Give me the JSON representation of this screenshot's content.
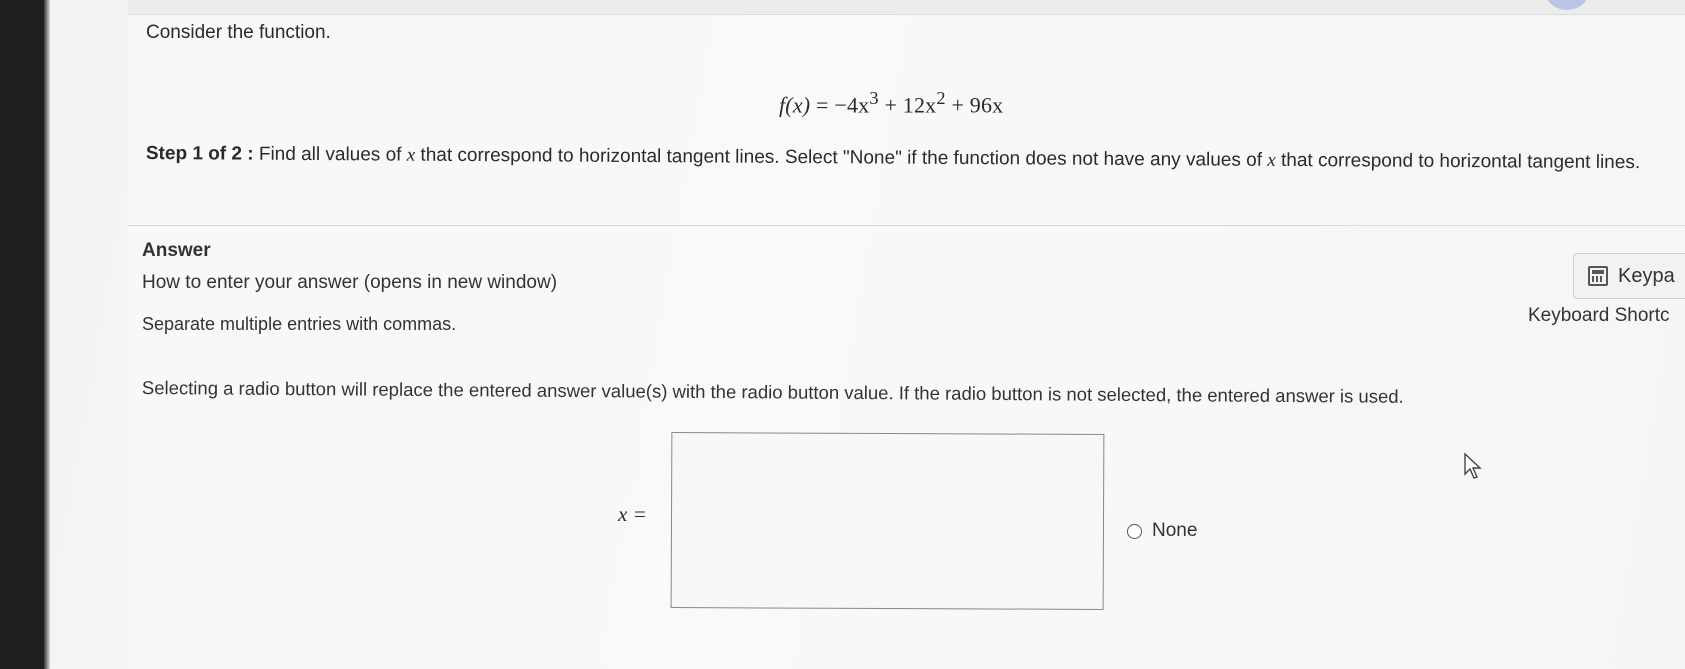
{
  "question": {
    "intro": "Consider the function.",
    "equation": {
      "lhs": "f(x)",
      "equals": "=",
      "term1": "−4x",
      "exp1": "3",
      "plus1": "+",
      "term2": "12x",
      "exp2": "2",
      "plus2": "+",
      "term3": "96x"
    },
    "step": {
      "label": "Step 1 of 2 :",
      "text_before_x": "Find all values of",
      "x1": "x",
      "text_middle": "that correspond to horizontal tangent lines. Select \"None\" if the function does not have any values of",
      "x2": "x",
      "text_after": "that correspond to horizontal tangent lines."
    }
  },
  "answer": {
    "heading": "Answer",
    "how_link": "How to enter your answer (opens in new window)",
    "separate_note": "Separate multiple entries with commas.",
    "radio_note": "Selecting a radio button will replace the entered answer value(s) with the radio button value. If the radio button is not selected, the entered answer is used.",
    "input_label": "x =",
    "input_value": "",
    "none_option": "None"
  },
  "tools": {
    "keypad_label": "Keypa",
    "keyboard_shortcuts": "Keyboard Shortc"
  },
  "icons": {
    "keypad": "calculator-icon",
    "radio": "radio-unselected-icon",
    "cursor": "mouse-pointer-icon"
  }
}
